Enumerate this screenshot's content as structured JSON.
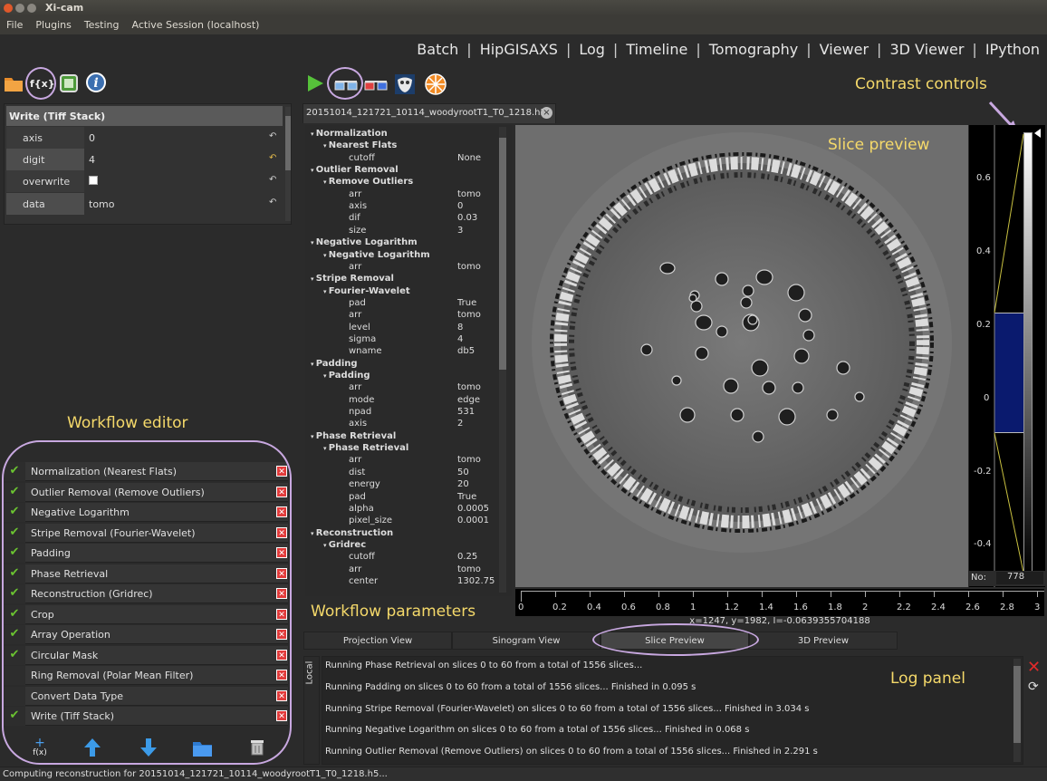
{
  "window": {
    "title": "Xi-cam"
  },
  "menu": [
    "File",
    "Plugins",
    "Testing",
    "Active Session (localhost)"
  ],
  "plugins": [
    "Batch",
    "HipGISAXS",
    "Log",
    "Timeline",
    "Tomography",
    "Viewer",
    "3D Viewer",
    "IPython"
  ],
  "left_toolbar_icons": [
    "folder-icon",
    "function-icon",
    "square-icon",
    "info-icon"
  ],
  "param_panel": {
    "title": "Write (Tiff Stack)",
    "rows": [
      {
        "label": "axis",
        "value": "0"
      },
      {
        "label": "digit",
        "value": "4"
      },
      {
        "label": "overwrite",
        "value": ""
      },
      {
        "label": "data",
        "value": "tomo"
      }
    ]
  },
  "annotations": {
    "workflow_editor": "Workflow editor",
    "workflow_parameters": "Workflow parameters",
    "contrast_controls": "Contrast controls",
    "slice_preview": "Slice preview",
    "log_panel": "Log panel"
  },
  "workflow": [
    {
      "name": "Normalization (Nearest Flats)",
      "enabled": true
    },
    {
      "name": "Outlier Removal (Remove Outliers)",
      "enabled": true
    },
    {
      "name": "Negative Logarithm",
      "enabled": true
    },
    {
      "name": "Stripe Removal (Fourier-Wavelet)",
      "enabled": true
    },
    {
      "name": "Padding",
      "enabled": true
    },
    {
      "name": "Phase Retrieval",
      "enabled": true
    },
    {
      "name": "Reconstruction (Gridrec)",
      "enabled": true
    },
    {
      "name": "Crop",
      "enabled": true
    },
    {
      "name": "Array Operation",
      "enabled": true
    },
    {
      "name": "Circular Mask",
      "enabled": true
    },
    {
      "name": "Ring Removal (Polar Mean Filter)",
      "enabled": false
    },
    {
      "name": "Convert Data Type",
      "enabled": false
    },
    {
      "name": "Write (Tiff Stack)",
      "enabled": true
    }
  ],
  "workflow_buttons": [
    "add-function-icon",
    "move-up-icon",
    "move-down-icon",
    "open-folder-icon",
    "delete-icon"
  ],
  "workflow_buttons_text": {
    "add": "f(x)"
  },
  "file_tab": {
    "name": "20151014_121721_10114_woodyrootT1_T0_1218.h5"
  },
  "tree": [
    {
      "lvl": 0,
      "text": "Normalization"
    },
    {
      "lvl": 1,
      "text": "Nearest Flats"
    },
    {
      "lvl": 2,
      "text": "cutoff",
      "val": "None"
    },
    {
      "lvl": 0,
      "text": "Outlier Removal"
    },
    {
      "lvl": 1,
      "text": "Remove Outliers"
    },
    {
      "lvl": 2,
      "text": "arr",
      "val": "tomo"
    },
    {
      "lvl": 2,
      "text": "axis",
      "val": "0"
    },
    {
      "lvl": 2,
      "text": "dif",
      "val": "0.03"
    },
    {
      "lvl": 2,
      "text": "size",
      "val": "3"
    },
    {
      "lvl": 0,
      "text": "Negative Logarithm"
    },
    {
      "lvl": 1,
      "text": "Negative Logarithm"
    },
    {
      "lvl": 2,
      "text": "arr",
      "val": "tomo"
    },
    {
      "lvl": 0,
      "text": "Stripe Removal"
    },
    {
      "lvl": 1,
      "text": "Fourier-Wavelet"
    },
    {
      "lvl": 2,
      "text": "pad",
      "val": "True"
    },
    {
      "lvl": 2,
      "text": "arr",
      "val": "tomo"
    },
    {
      "lvl": 2,
      "text": "level",
      "val": "8"
    },
    {
      "lvl": 2,
      "text": "sigma",
      "val": "4"
    },
    {
      "lvl": 2,
      "text": "wname",
      "val": "db5"
    },
    {
      "lvl": 0,
      "text": "Padding"
    },
    {
      "lvl": 1,
      "text": "Padding"
    },
    {
      "lvl": 2,
      "text": "arr",
      "val": "tomo"
    },
    {
      "lvl": 2,
      "text": "mode",
      "val": "edge"
    },
    {
      "lvl": 2,
      "text": "npad",
      "val": "531"
    },
    {
      "lvl": 2,
      "text": "axis",
      "val": "2"
    },
    {
      "lvl": 0,
      "text": "Phase Retrieval"
    },
    {
      "lvl": 1,
      "text": "Phase Retrieval"
    },
    {
      "lvl": 2,
      "text": "arr",
      "val": "tomo"
    },
    {
      "lvl": 2,
      "text": "dist",
      "val": "50"
    },
    {
      "lvl": 2,
      "text": "energy",
      "val": "20"
    },
    {
      "lvl": 2,
      "text": "pad",
      "val": "True"
    },
    {
      "lvl": 2,
      "text": "alpha",
      "val": "0.0005"
    },
    {
      "lvl": 2,
      "text": "pixel_size",
      "val": "0.0001"
    },
    {
      "lvl": 0,
      "text": "Reconstruction"
    },
    {
      "lvl": 1,
      "text": "Gridrec"
    },
    {
      "lvl": 2,
      "text": "cutoff",
      "val": "0.25"
    },
    {
      "lvl": 2,
      "text": "arr",
      "val": "tomo"
    },
    {
      "lvl": 2,
      "text": "center",
      "val": "1302.75"
    }
  ],
  "histogram_ticks": [
    "0.6",
    "0.4",
    "0.2",
    "0",
    "-0.2",
    "-0.4"
  ],
  "no_label": "No:",
  "slice_number": "778",
  "xaxis_ticks": [
    "0",
    "0.2",
    "0.4",
    "0.6",
    "0.8",
    "1",
    "1.2",
    "1.4",
    "1.6",
    "1.8",
    "2",
    "2.2",
    "2.4",
    "2.6",
    "2.8",
    "3"
  ],
  "coord_readout": "x=1247, y=1982, I=-0.0639355704188",
  "view_tabs": [
    "Projection View",
    "Sinogram View",
    "Slice Preview",
    "3D Preview"
  ],
  "active_view_tab": "Slice Preview",
  "log_side_label": "Local",
  "log_lines": [
    "Running Phase Retrieval on slices 0 to 60 from a total of 1556 slices...",
    "Running Padding on slices 0 to 60 from a total of 1556 slices... Finished in 0.095 s",
    "Running Stripe Removal (Fourier-Wavelet) on slices 0 to 60 from a total of 1556 slices... Finished in 3.034 s",
    "Running Negative Logarithm on slices 0 to 60 from a total of 1556 slices... Finished in 0.068 s",
    "Running Outlier Removal (Remove Outliers) on slices 0 to 60 from a total of 1556 slices... Finished in 2.291 s"
  ],
  "status": "Computing reconstruction for 20151014_121721_10114_woodyrootT1_T0_1218.h5...",
  "colors": {
    "accent_annotation": "#f5d96a",
    "ellipse": "#c8a8e0",
    "check": "#6bc431",
    "delete": "#e23b3b",
    "hist_fill": "#0a1a6e"
  }
}
